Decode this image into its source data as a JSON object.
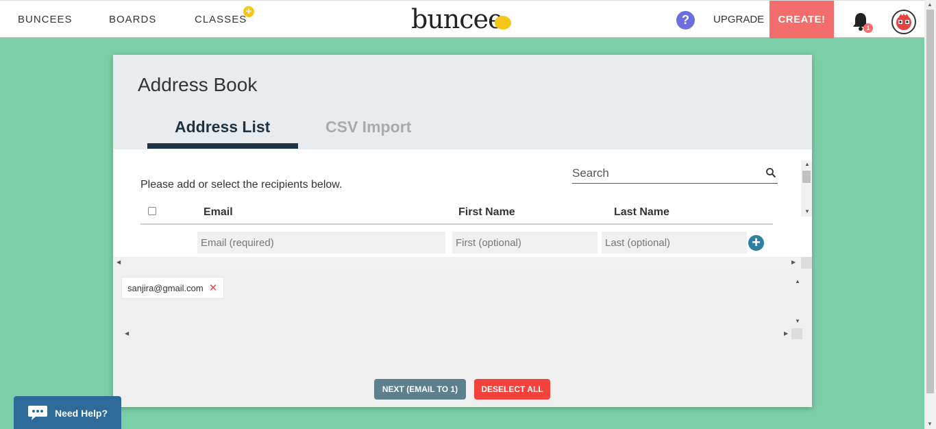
{
  "nav": {
    "buncees": "BUNCEES",
    "boards": "BOARDS",
    "classes": "CLASSES",
    "classes_badge": "+",
    "logo": "buncee",
    "help": "?",
    "upgrade": "UPGRADE",
    "create": "CREATE!",
    "notification_count": "1"
  },
  "dialog": {
    "title": "Address Book",
    "tabs": [
      {
        "label": "Address List",
        "active": true
      },
      {
        "label": "CSV Import",
        "active": false
      }
    ],
    "search_placeholder": "Search",
    "instructions": "Please add or select the recipients below.",
    "columns": {
      "email": "Email",
      "first": "First Name",
      "last": "Last Name"
    },
    "inputs": {
      "email_placeholder": "Email (required)",
      "first_placeholder": "First (optional)",
      "last_placeholder": "Last (optional)"
    },
    "add_symbol": "+",
    "selected": [
      {
        "email": "sanjira@gmail.com"
      }
    ],
    "remove_symbol": "✕",
    "next_button": "NEXT (EMAIL TO 1)",
    "deselect_button": "DESELECT ALL"
  },
  "help_widget": {
    "label": "Need Help?"
  },
  "colors": {
    "background": "#7bcfa8",
    "create": "#f46d6d",
    "accent_dark": "#1d3344",
    "next": "#5d7f8e",
    "deselect": "#f3413b",
    "help": "#2d6a9a",
    "logo_dot": "#f5c518"
  }
}
